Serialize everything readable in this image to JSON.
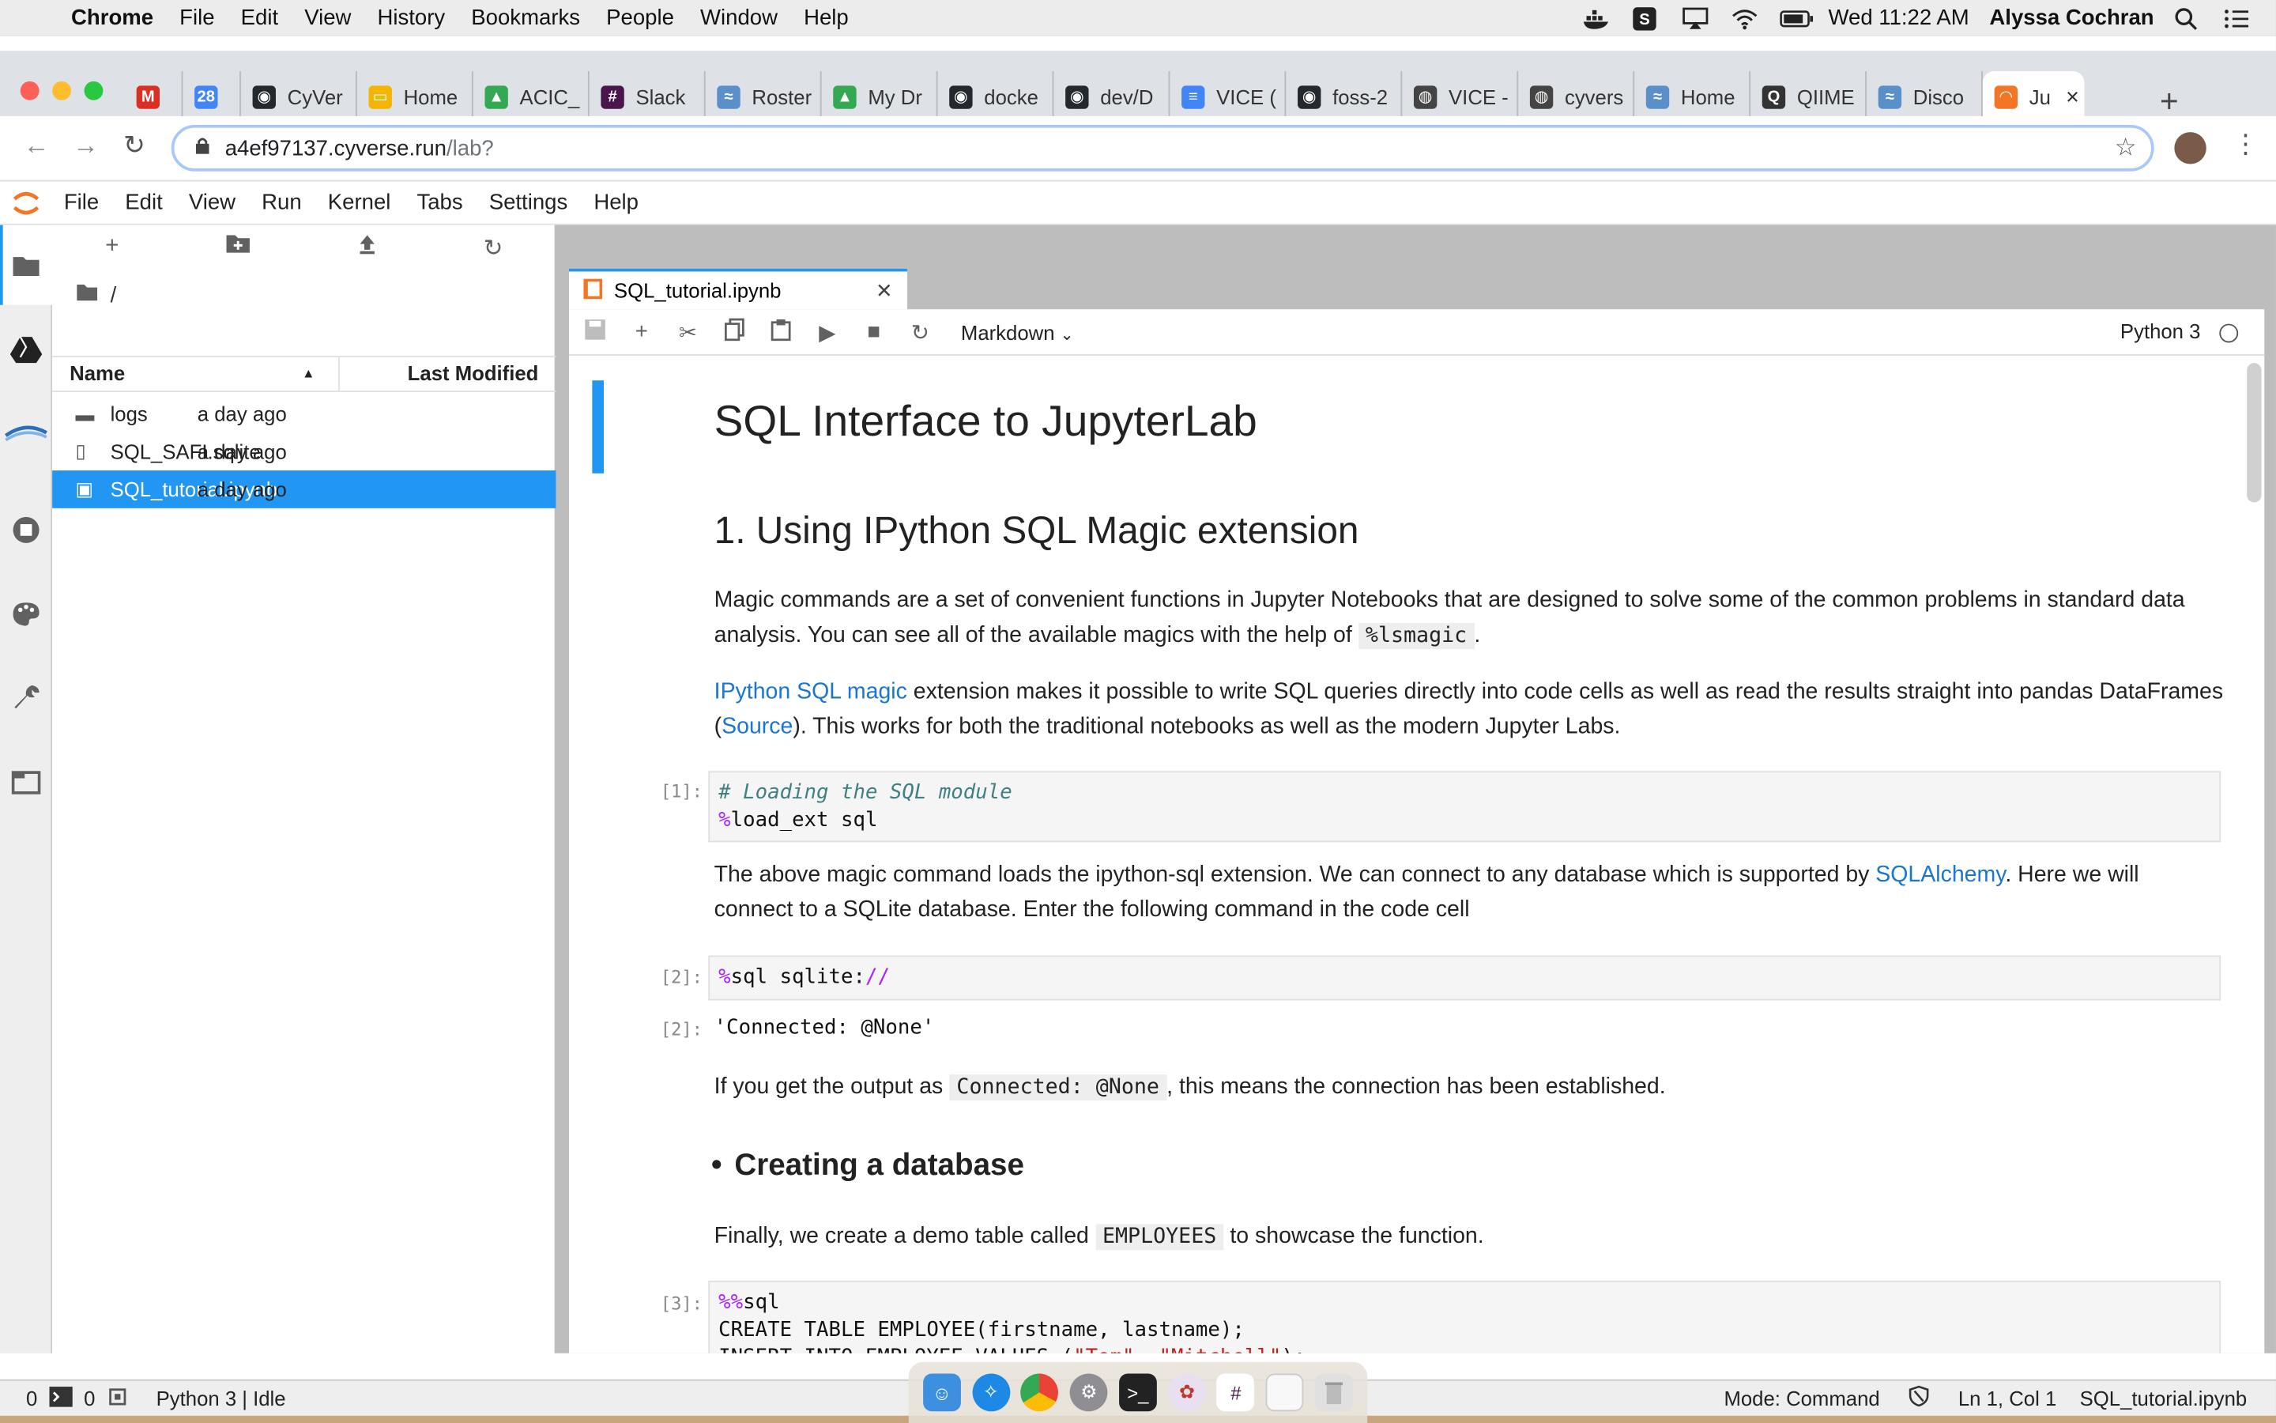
{
  "menubar": {
    "app": "Chrome",
    "items": [
      "File",
      "Edit",
      "View",
      "History",
      "Bookmarks",
      "People",
      "Window",
      "Help"
    ],
    "clock": "Wed 11:22 AM",
    "user": "Alyssa Cochran"
  },
  "browser": {
    "tabs": [
      {
        "label": "",
        "color": "#d93025",
        "glyph": "M"
      },
      {
        "label": "",
        "color": "#4285f4",
        "glyph": "28"
      },
      {
        "label": "CyVer",
        "color": "#24292e",
        "glyph": "◉"
      },
      {
        "label": "Home",
        "color": "#f4b400",
        "glyph": "▭"
      },
      {
        "label": "ACIC_",
        "color": "#34a853",
        "glyph": "▲"
      },
      {
        "label": "Slack",
        "color": "#4a154b",
        "glyph": "#"
      },
      {
        "label": "Roster",
        "color": "#5a8fc9",
        "glyph": "≈"
      },
      {
        "label": "My Dr",
        "color": "#34a853",
        "glyph": "▲"
      },
      {
        "label": "docke",
        "color": "#24292e",
        "glyph": "◉"
      },
      {
        "label": "dev/D",
        "color": "#24292e",
        "glyph": "◉"
      },
      {
        "label": "VICE (",
        "color": "#4285f4",
        "glyph": "≡"
      },
      {
        "label": "foss-2",
        "color": "#24292e",
        "glyph": "◉"
      },
      {
        "label": "VICE -",
        "color": "#444444",
        "glyph": "◍"
      },
      {
        "label": "cyvers",
        "color": "#444444",
        "glyph": "◍"
      },
      {
        "label": "Home",
        "color": "#5a8fc9",
        "glyph": "≈"
      },
      {
        "label": "QIIME",
        "color": "#333333",
        "glyph": "Q"
      },
      {
        "label": "Disco",
        "color": "#5a8fc9",
        "glyph": "≈"
      },
      {
        "label": "Ju",
        "color": "#f37626",
        "glyph": "◠",
        "active": true
      }
    ],
    "url_host": "a4ef97137.cyverse.run",
    "url_path": "/lab?"
  },
  "jupyter": {
    "menu": [
      "File",
      "Edit",
      "View",
      "Run",
      "Kernel",
      "Tabs",
      "Settings",
      "Help"
    ],
    "breadcrumb": "/",
    "file_header": {
      "name": "Name",
      "modified": "Last Modified"
    },
    "files": [
      {
        "icon": "folder-icon",
        "name": "logs",
        "modified": "a day ago",
        "selected": false
      },
      {
        "icon": "file-icon",
        "name": "SQL_SAFI.sqlite",
        "modified": "a day ago",
        "selected": false
      },
      {
        "icon": "notebook-icon",
        "name": "SQL_tutorial.ipynb",
        "modified": "a day ago",
        "selected": true
      }
    ],
    "notebook_tab": "SQL_tutorial.ipynb",
    "cell_type": "Markdown",
    "kernel": "Python 3"
  },
  "notebook": {
    "title": "SQL Interface to JupyterLab",
    "h2": "1. Using IPython SQL Magic extension",
    "p1a": "Magic commands are a set of convenient functions in Jupyter Notebooks that are designed to solve some of the common problems in standard data analysis. You can see all of the available magics with the help of",
    "p1code": "%lsmagic",
    "p1b": ".",
    "p2link": "IPython SQL magic",
    "p2a": "extension makes it possible to write SQL queries directly into code cells as well as read the results straight into pandas DataFrames (",
    "p2link2": "Source",
    "p2b": "). This works for both the traditional notebooks as well as the modern Jupyter Labs.",
    "cell1_prompt": "[1]:",
    "cell1_comment": "# Loading the SQL module",
    "cell1_magic": "%",
    "cell1_rest": "load_ext sql",
    "p3a": "The above magic command loads the ipython-sql extension. We can connect to any database which is supported by",
    "p3link": "SQLAlchemy",
    "p3b": ". Here we will connect to a SQLite database. Enter the following command in the code cell",
    "cell2_prompt": "[2]:",
    "cell2_magic": "%",
    "cell2_rest": "sql sqlite:",
    "cell2_slashes": "//",
    "out2_prompt": "[2]:",
    "out2": "'Connected: @None'",
    "p4a": "If you get the output as",
    "p4code": "Connected: @None",
    "p4b": ", this means the connection has been established.",
    "bullet": "Creating a database",
    "p5a": "Finally, we create a demo table called",
    "p5code": "EMPLOYEES",
    "p5b": "to showcase the function.",
    "cell3_prompt": "[3]:",
    "cell3_magic": "%%",
    "cell3_l1": "sql",
    "cell3_l2": "CREATE TABLE EMPLOYEE(firstname, lastname);",
    "cell3_l3a": "INSERT INTO EMPLOYEE VALUES (",
    "cell3_s1": "\"Tom\"",
    "cell3_sep": ", ",
    "cell3_s2": "\"Mitchell\"",
    "cell3_l3b": ");"
  },
  "status": {
    "left_count1": "0",
    "left_count2": "0",
    "kernel_state": "Python 3 | Idle",
    "mode": "Mode: Command",
    "position": "Ln 1, Col 1",
    "file": "SQL_tutorial.ipynb"
  },
  "colors": {
    "accent": "#2196f3",
    "jupyter_orange": "#f37626",
    "link": "#1976d2"
  }
}
